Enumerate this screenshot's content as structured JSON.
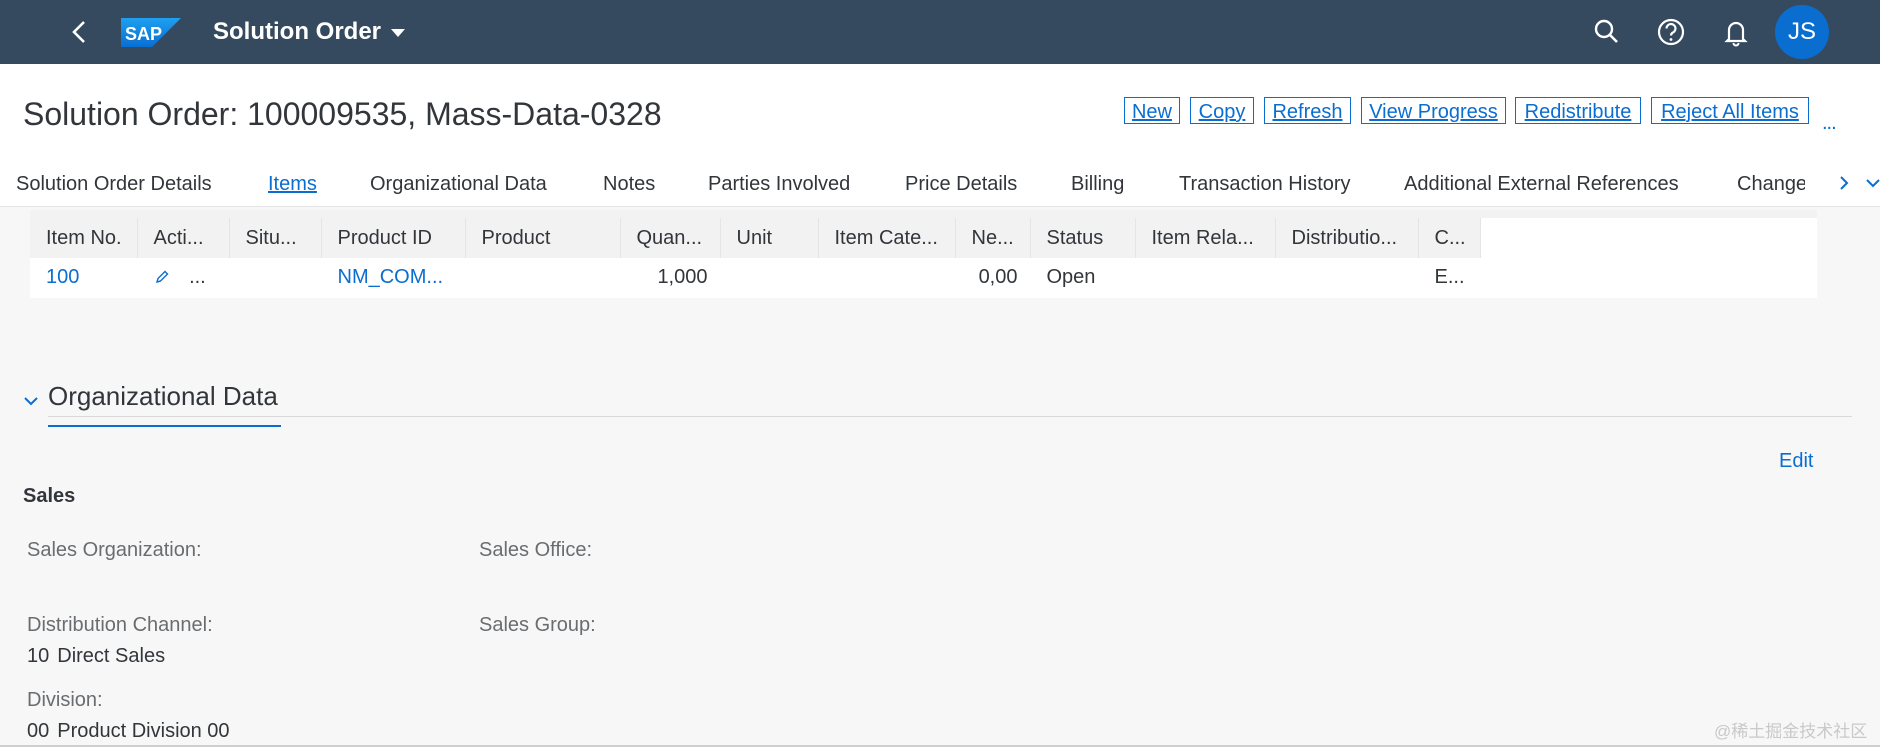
{
  "shell": {
    "app_title": "Solution Order",
    "logo_text": "SAP",
    "avatar_initials": "JS"
  },
  "header": {
    "title": "Solution Order: 100009535, Mass-Data-0328",
    "actions": [
      "New",
      "Copy",
      "Refresh",
      "View Progress",
      "Redistribute",
      "Reject All Items"
    ],
    "more": "..."
  },
  "tabs": [
    "Solution Order Details",
    "Items",
    "Organizational Data",
    "Notes",
    "Parties Involved",
    "Price Details",
    "Billing",
    "Transaction History",
    "Additional External References",
    "Change H"
  ],
  "active_tab": "Items",
  "items_table": {
    "columns": [
      "Item No.",
      "Acti...",
      "Situ...",
      "Product ID",
      "Product",
      "Quan...",
      "Unit",
      "Item Cate...",
      "Ne...",
      "Status",
      "Item Rela...",
      "Distributio...",
      "C..."
    ],
    "rows": [
      {
        "item_no": "100",
        "action_more": "...",
        "situation": "",
        "product_id": "NM_COM...",
        "product": "",
        "quantity": "1,000",
        "unit": "",
        "item_category": "",
        "net_value": "0,00",
        "status": "Open",
        "item_relation": "",
        "distribution": "",
        "c": "E..."
      }
    ]
  },
  "org_section": {
    "title": "Organizational Data",
    "edit_label": "Edit",
    "subsection": "Sales",
    "fields": {
      "sales_org_label": "Sales Organization:",
      "sales_office_label": "Sales Office:",
      "dist_channel_label": "Distribution Channel:",
      "dist_channel_code": "10",
      "dist_channel_name": "Direct Sales",
      "sales_group_label": "Sales Group:",
      "division_label": "Division:",
      "division_code": "00",
      "division_name": "Product Division 00"
    }
  },
  "watermark": "@稀土掘金技术社区",
  "colors": {
    "shell_bg": "#354a5f",
    "accent": "#0a6ed1",
    "avatar_bg": "#0a6ed1"
  }
}
